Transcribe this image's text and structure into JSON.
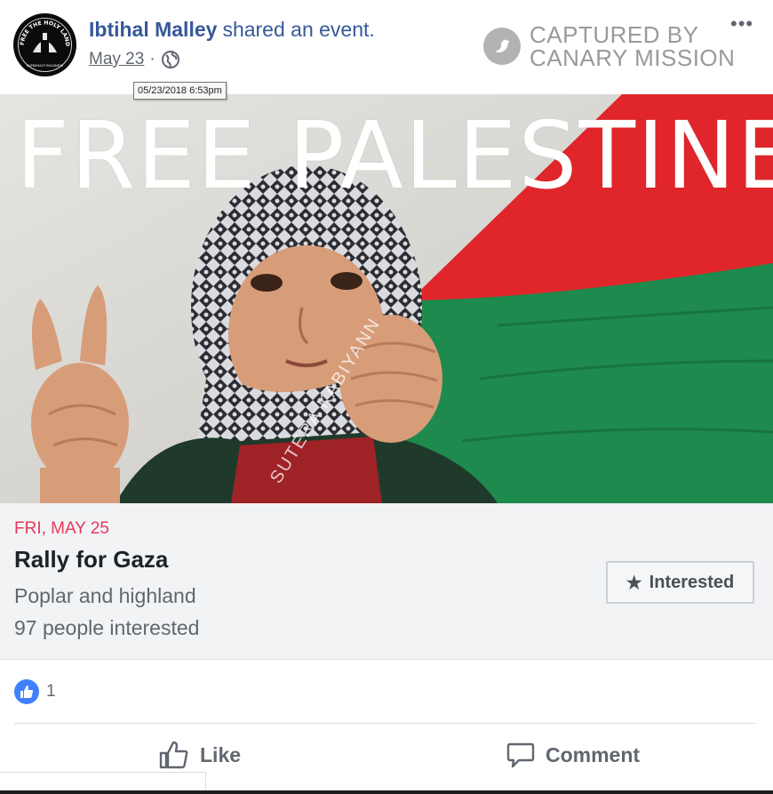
{
  "post": {
    "author": "Ibtihal Malley",
    "action": "shared an event.",
    "date": "May 23",
    "date_separator": "·",
    "timestamp_tooltip": "05/23/2018 6:53pm",
    "privacy_icon": "globe-icon",
    "more_label": "•••"
  },
  "avatar": {
    "text_top": "FREE THE HOLY LAND S",
    "text_bottom": "SUPREMACY BOLDNESS"
  },
  "watermark": {
    "line1": "CAPTURED BY",
    "line2": "CANARY MISSION",
    "icon": "canary-bird-icon"
  },
  "hero": {
    "title": "FREE PALESTINE",
    "signature": "SUTERA KABIYANN"
  },
  "event": {
    "date": "FRI, MAY 25",
    "title": "Rally for Gaza",
    "location": "Poplar and highland",
    "interested_count": "97 people interested",
    "interested_button": "Interested",
    "interested_icon": "star-icon"
  },
  "reactions": {
    "icon": "thumbs-up-icon",
    "count": "1"
  },
  "actions": {
    "like": "Like",
    "comment": "Comment"
  },
  "colors": {
    "link_blue": "#365899",
    "date_red": "#e4385b",
    "like_blue": "#4080ff",
    "flag_red": "#e0262a",
    "flag_green": "#1e8a4e"
  }
}
